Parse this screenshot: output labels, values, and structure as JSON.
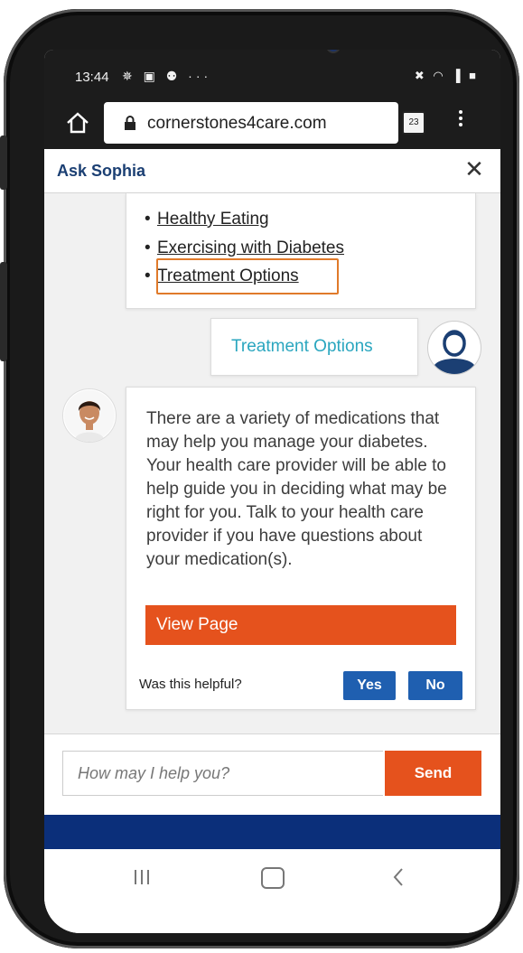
{
  "status_bar": {
    "time": "13:44",
    "left_icons": "✵ ▣ ⚉ ···",
    "right_icons": "✖ ◠ ▐ ■"
  },
  "browser": {
    "url": "cornerstones4care.com",
    "tab_count": "23"
  },
  "chat": {
    "title": "Ask Sophia",
    "close_label": "✕",
    "links": [
      "Healthy Eating",
      "Exercising with Diabetes",
      "Treatment Options"
    ],
    "bullet": "•",
    "user_message": "Treatment Options",
    "bot_message": "There are a variety of medications that may help you manage your diabetes. Your health care provider will be able to help guide you in deciding what may be right for you. Talk to your health care provider if you have questions about your medication(s).",
    "view_page_label": "View Page",
    "helpful_question": "Was this helpful?",
    "yes_label": "Yes",
    "no_label": "No"
  },
  "input": {
    "placeholder": "How may I help you?",
    "send_label": "Send"
  },
  "colors": {
    "accent_orange": "#e5521d",
    "brand_blue": "#1b3f73",
    "button_blue": "#1f5fb0",
    "teal_text": "#2aa6bf",
    "footer_bar": "#0b2f7a",
    "highlight_border": "#e07a2a"
  },
  "icons": [
    "home-icon",
    "lock-icon",
    "tabs-icon",
    "more-vert-icon",
    "close-icon",
    "user-avatar-icon",
    "bot-avatar-icon",
    "recent-apps-icon",
    "home-nav-icon",
    "back-icon"
  ]
}
